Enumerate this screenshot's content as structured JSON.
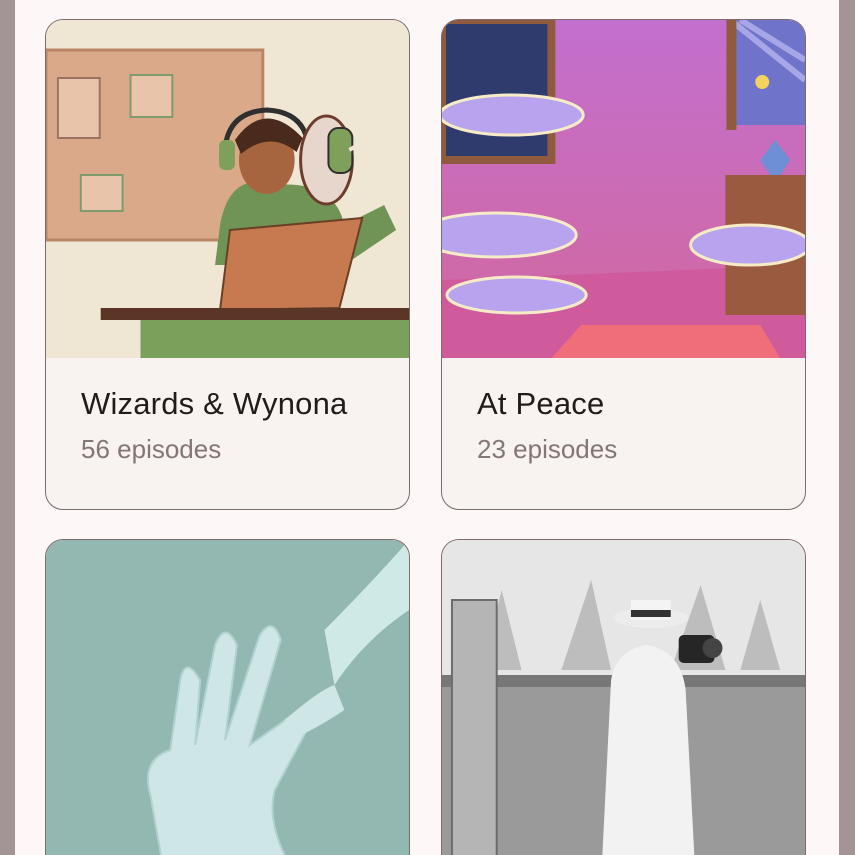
{
  "podcasts": [
    {
      "title": "Wizards & Wynona",
      "episodes": "56 episodes"
    },
    {
      "title": "At Peace",
      "episodes": "23 episodes"
    },
    {
      "title": "",
      "episodes": ""
    },
    {
      "title": "",
      "episodes": ""
    }
  ],
  "colors": {
    "surface": "#fdf8f7",
    "card_background": "#f8f2f1",
    "card_border": "#7d6a6a",
    "title_text": "#231a1a",
    "subtitle_text": "#857676",
    "scrim": "#a39595"
  }
}
